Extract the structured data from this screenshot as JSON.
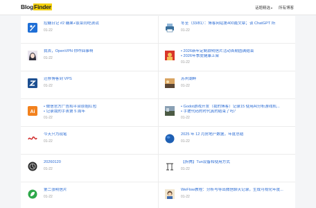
{
  "header": {
    "brand_prefix": "Blog",
    "brand_highlight": "Finder",
    "menu_label": "话题精选",
    "all_blogs_label": "所有博客"
  },
  "icons": [
    "blue-rocket-icon",
    "printer-icon",
    "anime-avatar-icon",
    "red-avatar-icon",
    "z-letter-icon",
    "sunset-photo-icon",
    "ai-badge-icon",
    "landscape-photo-icon",
    "red-squiggle-logo-icon",
    "blue-globe-icon",
    "dark-avatar-icon",
    "frame-outline-icon",
    "green-leaf-icon",
    "cartoon-avatar-icon"
  ],
  "posts": [
    {
      "title": "控糖日记 #2 糖果+饭菜同吃测试",
      "date": "01-22"
    },
    {
      "title": "冬至（33/81）：博客网站第400篇文章；谈 ChatGPT 所",
      "date": "01-22"
    },
    {
      "title": "我去，OpenVPN 你咋回事啊",
      "date": "01-22"
    },
    {
      "lines": [
        "• 2026新年定制款明信片活动首期圆满结束",
        "• 2026年季度健康上架"
      ],
      "date": "01-22"
    },
    {
      "title": "迁移博客到 VPS",
      "date": "01-22"
    },
    {
      "title": "苏州湖畔",
      "date": "01-22"
    },
    {
      "lines": [
        "• 微信官方广告和平台原始红包",
        "• 记录我的手表第 5 周年"
      ],
      "date": "01-22"
    },
    {
      "lines": [
        "• Godot游戏开发（我的博客）记录15 使用AI分析游戏机...",
        "• 手搓代码的时代真的结束了吗？"
      ],
      "date": "01-22"
    },
    {
      "title": "今天只为现笔",
      "date": "01-22"
    },
    {
      "title": "2025 年 12 月房地产数据，年度总结",
      "date": "01-22"
    },
    {
      "title": "20260120",
      "date": "01-22"
    },
    {
      "title": "【折腾】Tun设备和使用方式",
      "date": "01-22"
    },
    {
      "title": "第二张明信片",
      "date": "01-22"
    },
    {
      "title": "WeFlow教程：分析与导出微信聊天记录，生成可视化年度...",
      "date": "01-22"
    }
  ]
}
